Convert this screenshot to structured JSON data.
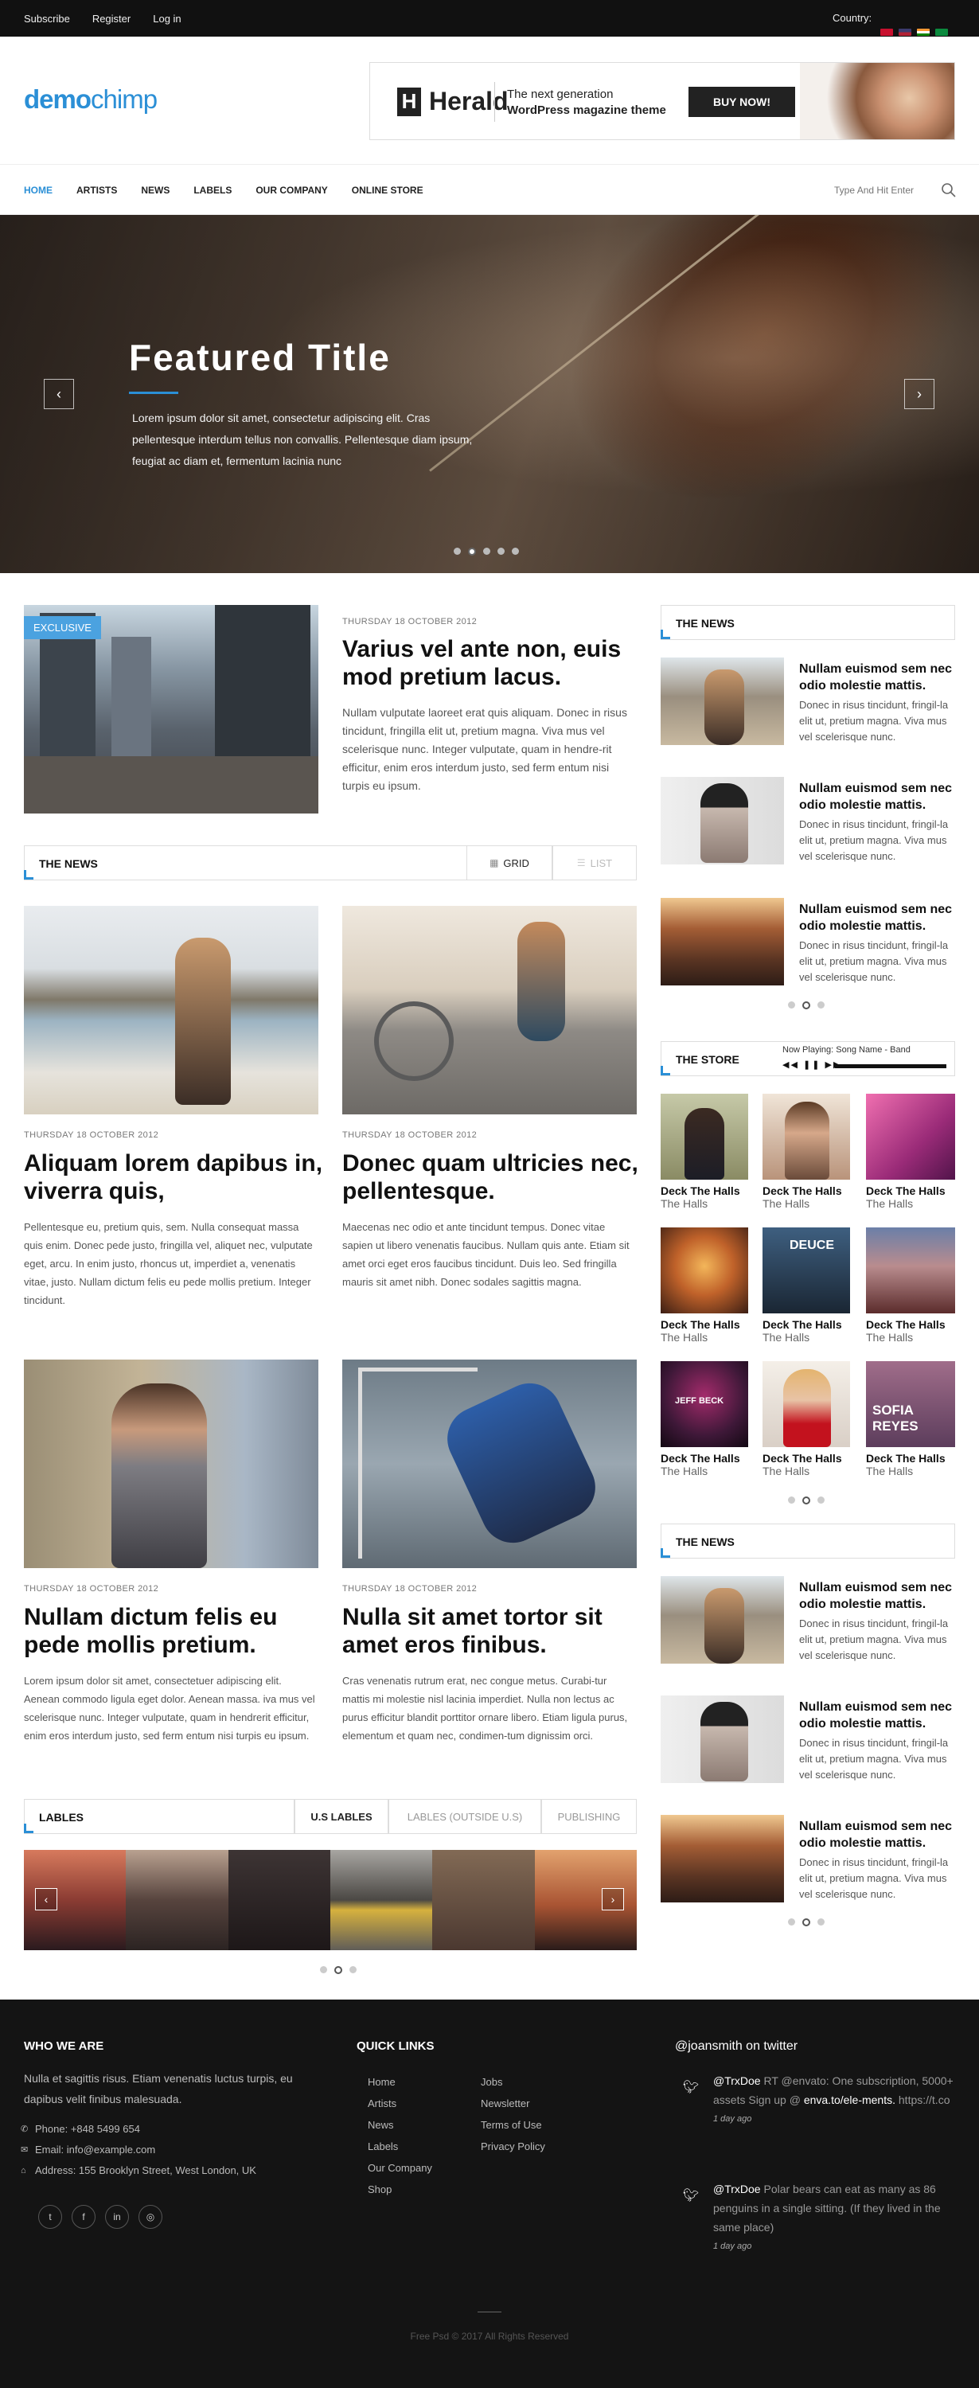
{
  "topbar": {
    "links": [
      "Subscribe",
      "Register",
      "Log in"
    ],
    "country_label": "Country:",
    "flag_colors": [
      "#c8102e",
      "#3c3b6e",
      "#ff9933",
      "#0b8a3e"
    ]
  },
  "header": {
    "logo_bold": "demo",
    "logo_light": "chimp",
    "ad": {
      "brand": "Herald",
      "brand_letter": "H",
      "line1": "The next generation",
      "line2": "WordPress magazine theme",
      "button": "BUY NOW!"
    }
  },
  "nav": {
    "items": [
      "HOME",
      "ARTISTS",
      "NEWS",
      "LABELS",
      "OUR COMPANY",
      "ONLINE STORE"
    ],
    "active": "HOME",
    "search_placeholder": "Type And Hit Enter"
  },
  "hero": {
    "title": "Featured Title",
    "text": "Lorem ipsum dolor sit amet, consectetur adipiscing elit. Cras pellentesque interdum tellus non convallis. Pellentesque diam ipsum, feugiat ac diam et, fermentum lacinia nunc",
    "prev": "‹",
    "next": "›",
    "slide_count": 5,
    "active_slide": 2
  },
  "featured": {
    "badge": "EXCLUSIVE",
    "date": "THURSDAY 18 OCTOBER 2012",
    "title": "Varius vel ante non, euis mod pretium lacus.",
    "text": "Nullam vulputate laoreet erat quis aliquam. Donec in risus tincidunt, fringilla elit ut, pretium magna. Viva mus vel scelerisque nunc. Integer vulputate, quam in hendre-rit efficitur, enim eros interdum justo, sed ferm entum nisi turpis eu ipsum."
  },
  "news_section": {
    "title": "THE NEWS",
    "grid_label": "GRID",
    "list_label": "LIST"
  },
  "articles": [
    {
      "date": "THURSDAY 18 OCTOBER 2012",
      "title": "Aliquam lorem dapibus in, viverra quis,",
      "text": "Pellentesque eu, pretium quis, sem. Nulla consequat massa quis enim. Donec pede justo, fringilla vel, aliquet nec, vulputate eget, arcu. In enim justo, rhoncus ut, imperdiet a, venenatis vitae, justo. Nullam dictum felis eu pede mollis pretium. Integer tincidunt."
    },
    {
      "date": "THURSDAY 18 OCTOBER 2012",
      "title": "Donec quam ultricies nec, pellentesque.",
      "text": "Maecenas nec odio et ante tincidunt tempus. Donec vitae sapien ut libero venenatis faucibus. Nullam quis ante. Etiam sit amet orci eget eros faucibus tincidunt. Duis leo. Sed fringilla mauris sit amet nibh. Donec sodales sagittis magna."
    },
    {
      "date": "THURSDAY 18 OCTOBER 2012",
      "title": "Nullam dictum felis eu pede mollis pretium.",
      "text": "Lorem ipsum dolor sit amet, consectetuer adipiscing elit. Aenean commodo ligula eget dolor. Aenean massa. iva mus vel scelerisque nunc. Integer vulputate, quam in hendrerit efficitur, enim eros interdum justo, sed ferm entum nisi turpis eu ipsum."
    },
    {
      "date": "THURSDAY 18 OCTOBER 2012",
      "title": "Nulla sit amet tortor sit amet eros finibus.",
      "text": "Cras venenatis rutrum erat, nec congue metus. Curabi-tur mattis mi molestie nisl lacinia imperdiet. Nulla non lectus ac purus efficitur blandit porttitor ornare libero. Etiam ligula purus, elementum et quam nec, condimen-tum dignissim orci."
    }
  ],
  "labels_section": {
    "title": "LABLES",
    "tabs": [
      "U.S LABLES",
      "LABLES (OUTSIDE U.S)",
      "PUBLISHING"
    ],
    "prev": "‹",
    "next": "›"
  },
  "sidebar_news": {
    "title": "THE NEWS",
    "items": [
      {
        "title": "Nullam euismod sem nec odio molestie mattis.",
        "text": "Donec in risus tincidunt, fringil-la elit ut, pretium magna. Viva mus vel scelerisque nunc."
      },
      {
        "title": "Nullam euismod sem nec odio molestie mattis.",
        "text": "Donec in risus tincidunt, fringil-la elit ut, pretium magna. Viva mus vel scelerisque nunc."
      },
      {
        "title": "Nullam euismod sem nec odio molestie mattis.",
        "text": "Donec in risus tincidunt, fringil-la elit ut, pretium magna. Viva mus vel scelerisque nunc."
      }
    ]
  },
  "store": {
    "title": "THE STORE",
    "now_playing": "Now Playing: Song Name - Band",
    "items": [
      {
        "name": "Deck The Halls",
        "sub": "The Halls",
        "cover_text": ""
      },
      {
        "name": "Deck The Halls",
        "sub": "The Halls",
        "cover_text": ""
      },
      {
        "name": "Deck The Halls",
        "sub": "The Halls",
        "cover_text": ""
      },
      {
        "name": "Deck The Halls",
        "sub": "The Halls",
        "cover_text": ""
      },
      {
        "name": "Deck The Halls",
        "sub": "The Halls",
        "cover_text": "DEUCE"
      },
      {
        "name": "Deck The Halls",
        "sub": "The Halls",
        "cover_text": ""
      },
      {
        "name": "Deck The Halls",
        "sub": "The Halls",
        "cover_text": "JEFF BECK"
      },
      {
        "name": "Deck The Halls",
        "sub": "The Halls",
        "cover_text": ""
      },
      {
        "name": "Deck The Halls",
        "sub": "The Halls",
        "cover_text": "SOFIA REYES"
      }
    ]
  },
  "sidebar_news2": {
    "title": "THE NEWS",
    "items": [
      {
        "title": "Nullam euismod sem nec odio molestie mattis.",
        "text": "Donec in risus tincidunt, fringil-la elit ut, pretium magna. Viva mus vel scelerisque nunc."
      },
      {
        "title": "Nullam euismod sem nec odio molestie mattis.",
        "text": "Donec in risus tincidunt, fringil-la elit ut, pretium magna. Viva mus vel scelerisque nunc."
      },
      {
        "title": "Nullam euismod sem nec odio molestie mattis.",
        "text": "Donec in risus tincidunt, fringil-la elit ut, pretium magna. Viva mus vel scelerisque nunc."
      }
    ]
  },
  "footer": {
    "who_title": "WHO WE ARE",
    "who_text": "Nulla et sagittis risus. Etiam venenatis luctus turpis, eu dapibus velit finibus malesuada.",
    "phone": "Phone: +848 5499 654",
    "email": "Email: info@example.com",
    "address": "Address: 155 Brooklyn Street, West London, UK",
    "quick_title": "QUICK LINKS",
    "quick_col1": [
      "Home",
      "Artists",
      "News",
      "Labels",
      "Our Company",
      "Shop"
    ],
    "quick_col2": [
      "Jobs",
      "Newsletter",
      "Terms of Use",
      "Privacy Policy"
    ],
    "twitter_title": "@joansmith on twitter",
    "tweets": [
      {
        "handle": "@TrxDoe",
        "pre": " RT @envato: One subscription, 5000+ assets  Sign up @ ",
        "link": "enva.to/ele-ments.",
        "post": " https://t.co",
        "ago": "1 day ago"
      },
      {
        "handle": "@TrxDoe",
        "pre": " Polar bears can eat as many as 86 penguins in a single sitting. (If they lived in the same place)",
        "link": "",
        "post": "",
        "ago": "1 day ago"
      }
    ],
    "copyright": "Free Psd © 2017 All Rights Reserved"
  },
  "colors": {
    "accent": "#2b8fd6",
    "badge": "#4ba2e0",
    "footer_bg": "#141414"
  }
}
